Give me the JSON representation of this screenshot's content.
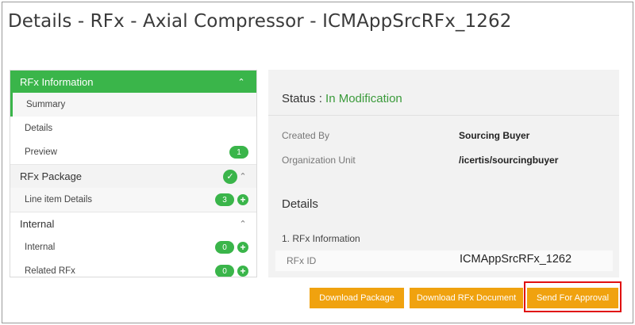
{
  "header": {
    "title": "Details - RFx - Axial Compressor - ICMAppSrcRFx_1262"
  },
  "sidebar": {
    "sections": [
      {
        "label": "RFx Information",
        "items": [
          {
            "label": "Summary"
          },
          {
            "label": "Details"
          },
          {
            "label": "Preview",
            "badge": "1"
          }
        ]
      },
      {
        "label": "RFx Package",
        "items": [
          {
            "label": "Line item Details",
            "badge": "3"
          }
        ]
      },
      {
        "label": "Internal",
        "items": [
          {
            "label": "Internal",
            "badge": "0"
          },
          {
            "label": "Related RFx",
            "badge": "0"
          }
        ]
      }
    ]
  },
  "main": {
    "status_label": "Status :",
    "status_value": "In Modification",
    "created_by_label": "Created By",
    "created_by_value": "Sourcing Buyer",
    "org_unit_label": "Organization Unit",
    "org_unit_value": "/icertis/sourcingbuyer",
    "details_heading": "Details",
    "section_title": "1. RFx Information",
    "rfx_id_label": "RFx ID",
    "rfx_id_value": "ICMAppSrcRFx_1262"
  },
  "actions": {
    "download_package": "Download Package",
    "download_rfx_document": "Download RFx Document",
    "send_for_approval": "Send For Approval"
  },
  "colors": {
    "accent_green": "#3ab54a",
    "button_orange": "#f0a20f",
    "highlight_red": "#e01010"
  },
  "icons": {
    "collapse": "chevron-up-icon",
    "complete": "check-circle-icon",
    "add": "plus-circle-icon"
  }
}
